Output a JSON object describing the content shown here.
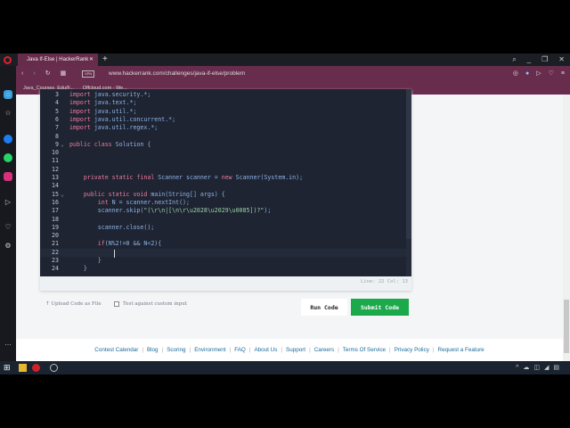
{
  "browser": {
    "tab_title": "Java If-Else | HackerRank",
    "url": "www.hackerrank.com/challenges/java-if-else/problem",
    "vpn_label": "VPN",
    "bookmarks": [
      "Java_Courses_Edu/F...",
      "Offcloud.com - We..."
    ]
  },
  "editor": {
    "lines": [
      {
        "n": "3",
        "parts": [
          [
            "kw",
            "import "
          ],
          [
            "tx",
            "java.security.*;"
          ]
        ]
      },
      {
        "n": "4",
        "parts": [
          [
            "kw",
            "import "
          ],
          [
            "tx",
            "java.text.*;"
          ]
        ]
      },
      {
        "n": "5",
        "parts": [
          [
            "kw",
            "import "
          ],
          [
            "tx",
            "java.util.*;"
          ]
        ]
      },
      {
        "n": "6",
        "parts": [
          [
            "kw",
            "import "
          ],
          [
            "tx",
            "java.util.concurrent.*;"
          ]
        ]
      },
      {
        "n": "7",
        "parts": [
          [
            "kw",
            "import "
          ],
          [
            "tx",
            "java.util.regex.*;"
          ]
        ]
      },
      {
        "n": "8",
        "parts": []
      },
      {
        "n": "9",
        "fold": true,
        "parts": [
          [
            "kw",
            "public class "
          ],
          [
            "tx",
            "Solution {"
          ]
        ]
      },
      {
        "n": "10",
        "parts": []
      },
      {
        "n": "11",
        "parts": []
      },
      {
        "n": "12",
        "parts": []
      },
      {
        "n": "13",
        "parts": [
          [
            "tx",
            "    "
          ],
          [
            "kw",
            "private static final "
          ],
          [
            "tx",
            "Scanner scanner = "
          ],
          [
            "kw",
            "new "
          ],
          [
            "tx",
            "Scanner(System.in);"
          ]
        ]
      },
      {
        "n": "14",
        "parts": []
      },
      {
        "n": "15",
        "fold": true,
        "parts": [
          [
            "tx",
            "    "
          ],
          [
            "kw",
            "public static void "
          ],
          [
            "tx",
            "main(String[] args) {"
          ]
        ]
      },
      {
        "n": "16",
        "parts": [
          [
            "tx",
            "        "
          ],
          [
            "kw",
            "int "
          ],
          [
            "tx",
            "N = scanner.nextInt();"
          ]
        ]
      },
      {
        "n": "17",
        "parts": [
          [
            "tx",
            "        scanner.skip("
          ],
          [
            "str",
            "\"(\\r\\n|[\\n\\r\\u2028\\u2029\\u0085])?\""
          ],
          [
            "tx",
            ");"
          ]
        ]
      },
      {
        "n": "18",
        "parts": []
      },
      {
        "n": "19",
        "parts": [
          [
            "tx",
            "        scanner.close();"
          ]
        ]
      },
      {
        "n": "20",
        "parts": []
      },
      {
        "n": "21",
        "parts": [
          [
            "tx",
            "        "
          ],
          [
            "kw",
            "if"
          ],
          [
            "tx",
            "(N%2!=0 && N<2){"
          ]
        ]
      },
      {
        "n": "22",
        "parts": []
      },
      {
        "n": "23",
        "parts": [
          [
            "tx",
            "        }"
          ]
        ]
      },
      {
        "n": "24",
        "parts": [
          [
            "tx",
            "    }"
          ]
        ]
      }
    ],
    "status": "Line: 22 Col: 13"
  },
  "actions": {
    "upload": "Upload Code as File",
    "custom_input": "Test against custom input",
    "run": "Run Code",
    "submit": "Submit Code"
  },
  "footer": [
    "Contest Calendar",
    "Blog",
    "Scoring",
    "Environment",
    "FAQ",
    "About Us",
    "Support",
    "Careers",
    "Terms Of Service",
    "Privacy Policy",
    "Request a Feature"
  ]
}
